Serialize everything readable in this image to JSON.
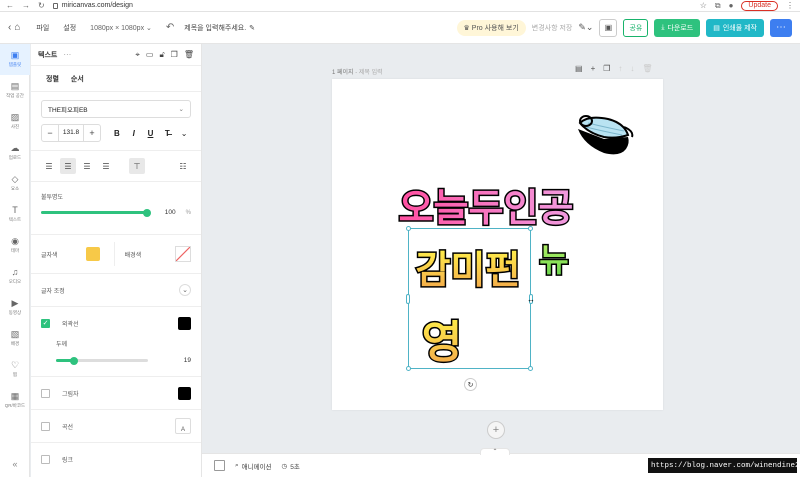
{
  "browser": {
    "url": "miricanvas.com/design",
    "update_label": "Update"
  },
  "appbar": {
    "menu_file": "파일",
    "menu_settings": "설정",
    "size": "1080px × 1080px",
    "title_placeholder": "제목을 입력해주세요.",
    "pro_label": "Pro 사용해 보기",
    "history_label": "변경사항 저장",
    "share_label": "공유",
    "download_label": "다운로드",
    "print_label": "인쇄물 제작"
  },
  "rail": [
    {
      "label": "템플릿",
      "icon": "template-icon",
      "glyph": "▣"
    },
    {
      "label": "작업 공간",
      "icon": "workspace-icon",
      "glyph": "▤"
    },
    {
      "label": "사진",
      "icon": "photo-icon",
      "glyph": "▨"
    },
    {
      "label": "업로드",
      "icon": "upload-icon",
      "glyph": "☁"
    },
    {
      "label": "요소",
      "icon": "elements-icon",
      "glyph": "◇"
    },
    {
      "label": "텍스트",
      "icon": "text-icon",
      "glyph": "T"
    },
    {
      "label": "테마",
      "icon": "theme-icon",
      "glyph": "◉"
    },
    {
      "label": "오디오",
      "icon": "audio-icon",
      "glyph": "♫"
    },
    {
      "label": "동영상",
      "icon": "video-icon",
      "glyph": "▶"
    },
    {
      "label": "배경",
      "icon": "background-icon",
      "glyph": "▧"
    },
    {
      "label": "찜",
      "icon": "heart-icon",
      "glyph": "♡"
    },
    {
      "label": "QR/바코드",
      "icon": "qr-icon",
      "glyph": "▦"
    }
  ],
  "panel": {
    "title": "텍스트",
    "tab_align": "정렬",
    "tab_order": "순서",
    "font_name": "THE피오피EB",
    "font_size": "131.8",
    "bold": "B",
    "italic": "I",
    "underline": "U",
    "strike": "T̶",
    "opacity_label": "불투명도",
    "opacity_value": "100",
    "opacity_unit": "%",
    "opacity_fraction": 1.0,
    "text_color_label": "글자색",
    "bg_color_label": "배경색",
    "text_adjust_label": "글자 조정",
    "outline_label": "외곽선",
    "thickness_label": "두께",
    "thickness_value": "19",
    "thickness_fraction": 0.2,
    "shadow_label": "그림자",
    "curve_label": "곡선",
    "link_label": "링크",
    "text_color": "#f7c948"
  },
  "canvas": {
    "page_label": "1 페이지",
    "page_sub": " - 제목 입력",
    "art_lines": [
      "오늘두인공",
      "감미펀",
      "영"
    ],
    "art_overlay": "뉴"
  },
  "bottom": {
    "animation_label": "애니메이션",
    "duration_label": "5초"
  },
  "watermark": "https://blog.naver.com/winendine2017"
}
